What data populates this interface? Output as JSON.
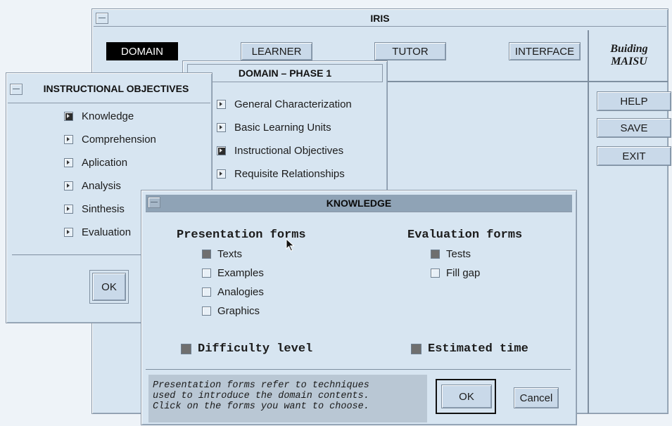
{
  "iris": {
    "title": "IRIS",
    "tabs": [
      {
        "label": "DOMAIN"
      },
      {
        "label": "LEARNER"
      },
      {
        "label": "TUTOR"
      },
      {
        "label": "INTERFACE"
      }
    ],
    "brand_line1": "Buiding",
    "brand_line2": "MAISU",
    "help_label": "HELP",
    "save_label": "SAVE",
    "exit_label": "EXIT"
  },
  "domain_phase": {
    "title": "DOMAIN – PHASE 1",
    "items": [
      {
        "label": "General Characterization"
      },
      {
        "label": "Basic Learning Units"
      },
      {
        "label": "Instructional Objectives"
      },
      {
        "label": "Requisite Relationships"
      }
    ]
  },
  "objectives": {
    "title": "INSTRUCTIONAL OBJECTIVES",
    "items": [
      {
        "label": "Knowledge"
      },
      {
        "label": "Comprehension"
      },
      {
        "label": "Aplication"
      },
      {
        "label": "Analysis"
      },
      {
        "label": "Sinthesis"
      },
      {
        "label": "Evaluation"
      }
    ],
    "ok_label": "OK"
  },
  "knowledge": {
    "title": "KNOWLEDGE",
    "presentation_heading": "Presentation forms",
    "presentation_options": [
      {
        "label": "Texts",
        "checked": true
      },
      {
        "label": "Examples",
        "checked": false
      },
      {
        "label": "Analogies",
        "checked": false
      },
      {
        "label": "Graphics",
        "checked": false
      }
    ],
    "evaluation_heading": "Evaluation forms",
    "evaluation_options": [
      {
        "label": "Tests",
        "checked": true
      },
      {
        "label": "Fill gap",
        "checked": false
      }
    ],
    "difficulty_label": "Difficulty level",
    "estimated_label": "Estimated time",
    "help_line1": "Presentation forms refer to techniques",
    "help_line2": "used to introduce the domain contents.",
    "help_line3": "Click on the forms you want to choose.",
    "ok_label": "OK",
    "cancel_label": "Cancel"
  }
}
